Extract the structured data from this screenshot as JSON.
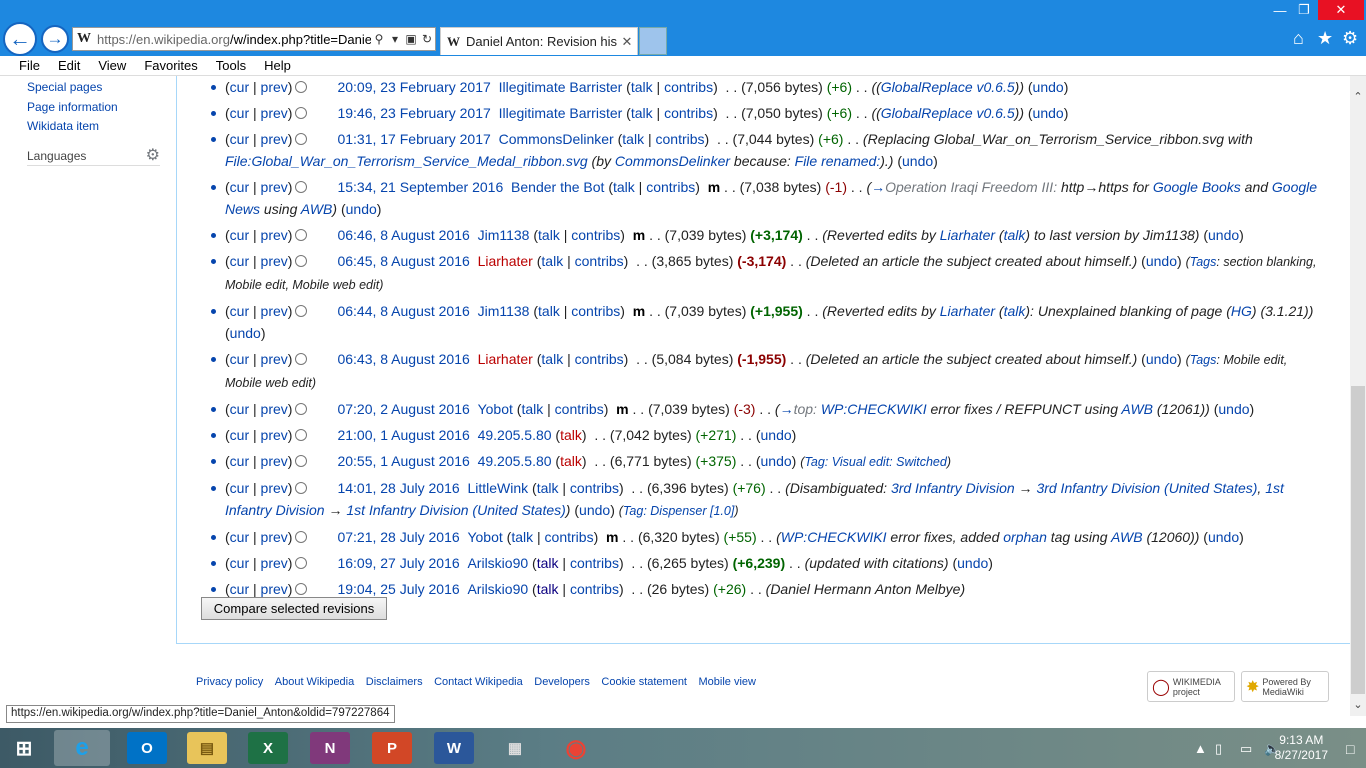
{
  "browser": {
    "address_host": "https://en.wikipedia.org",
    "address_path": "/w/index.php?title=Daniel_",
    "tab_title": "Daniel Anton: Revision hist...",
    "wiki_logo": "W"
  },
  "menu": [
    "File",
    "Edit",
    "View",
    "Favorites",
    "Tools",
    "Help"
  ],
  "sidebar": {
    "items": [
      "Special pages",
      "Page information",
      "Wikidata item"
    ],
    "languages": "Languages"
  },
  "compare_button": "Compare selected revisions",
  "footer_links": [
    "Privacy policy",
    "About Wikipedia",
    "Disclaimers",
    "Contact Wikipedia",
    "Developers",
    "Cookie statement",
    "Mobile view"
  ],
  "footer_badges": {
    "wikimedia": "WIKIMEDIA project",
    "mediawiki": "Powered By MediaWiki"
  },
  "status_url": "https://en.wikipedia.org/w/index.php?title=Daniel_Anton&oldid=797227864",
  "clock": {
    "time": "9:13 AM",
    "date": "8/27/2017"
  },
  "common": {
    "cur": "cur",
    "prev": "prev",
    "talk": "talk",
    "contribs": "contribs",
    "undo": "undo",
    "minor": "m"
  },
  "revisions": [
    {
      "date": "20:09, 23 February 2017",
      "user": "Illegitimate Barrister",
      "bytes": "(7,056 bytes)",
      "diff": "(+6)"
    },
    {
      "date": "19:46, 23 February 2017",
      "user": "Illegitimate Barrister",
      "bytes": "(7,050 bytes)",
      "diff": "(+6)"
    },
    {
      "date": "01:31, 17 February 2017",
      "user": "CommonsDelinker",
      "bytes": "(7,044 bytes)",
      "diff": "(+6)"
    },
    {
      "date": "15:34, 21 September 2016",
      "user": "Bender the Bot",
      "bytes": "(7,038 bytes)",
      "diff": "(-1)"
    },
    {
      "date": "06:46, 8 August 2016",
      "user": "Jim1138",
      "bytes": "(7,039 bytes)",
      "diff": "(+3,174)"
    },
    {
      "date": "06:45, 8 August 2016",
      "user": "Liarhater",
      "bytes": "(3,865 bytes)",
      "diff": "(-3,174)"
    },
    {
      "date": "06:44, 8 August 2016",
      "user": "Jim1138",
      "bytes": "(7,039 bytes)",
      "diff": "(+1,955)"
    },
    {
      "date": "06:43, 8 August 2016",
      "user": "Liarhater",
      "bytes": "(5,084 bytes)",
      "diff": "(-1,955)"
    },
    {
      "date": "07:20, 2 August 2016",
      "user": "Yobot",
      "bytes": "(7,039 bytes)",
      "diff": "(-3)"
    },
    {
      "date": "21:00, 1 August 2016",
      "user": "49.205.5.80",
      "bytes": "(7,042 bytes)",
      "diff": "(+271)"
    },
    {
      "date": "20:55, 1 August 2016",
      "user": "49.205.5.80",
      "bytes": "(6,771 bytes)",
      "diff": "(+375)"
    },
    {
      "date": "14:01, 28 July 2016",
      "user": "LittleWink",
      "bytes": "(6,396 bytes)",
      "diff": "(+76)"
    },
    {
      "date": "07:21, 28 July 2016",
      "user": "Yobot",
      "bytes": "(6,320 bytes)",
      "diff": "(+55)"
    },
    {
      "date": "16:09, 27 July 2016",
      "user": "Arilskio90",
      "bytes": "(6,265 bytes)",
      "diff": "(+6,239)"
    },
    {
      "date": "19:04, 25 July 2016",
      "user": "Arilskio90",
      "bytes": "(26 bytes)",
      "diff": "(+26)"
    }
  ],
  "summaries": {
    "gr_tool": "GlobalReplace v0.6.5",
    "r2_pre": "Replacing Global_War_on_Terrorism_Service_ribbon.svg with",
    "r2_file": "File:Global_War_on_Terrorism_Service_Medal_ribbon.svg",
    "r2_by": "by",
    "r2_because": "because:",
    "r2_reason": "File renamed:",
    "r3_section": "Operation Iraqi Freedom III:",
    "r3_text": "http→https for",
    "r3_gb": "Google Books",
    "r3_and": "and",
    "r3_gn": "Google News",
    "r3_using": "using",
    "awb": "AWB",
    "r4_pre": "Reverted edits by",
    "r4_post": "to last version by Jim1138",
    "r5_text": "Deleted an article the subject created about himself.",
    "tags": "Tags",
    "r5_tags": "section blanking, Mobile edit, Mobile web edit",
    "r6_post": "Unexplained blanking of page",
    "hg": "HG",
    "r6_ver": "(3.1.21)",
    "r7_tags": "Mobile edit, Mobile web edit",
    "r8_top": "top:",
    "checkwiki": "WP:CHECKWIKI",
    "r8_text": "error fixes / REFPUNCT using",
    "r8_ver": "(12061)",
    "r10_tag": "Tag: Visual edit: Switched",
    "r11_pre": "Disambiguated:",
    "r11_a": "3rd Infantry Division",
    "r11_b": "3rd Infantry Division (United States)",
    "r11_c": "1st Infantry Division",
    "r11_d": "1st Infantry Division (United States)",
    "r11_tag": "Tag: Dispenser [1.0]",
    "r12_text": "error fixes, added",
    "orphan": "orphan",
    "r12_tag": "tag using",
    "r12_ver": "(12060)",
    "r13_text": "updated with citations",
    "r14_text": "Daniel Hermann Anton Melbye"
  },
  "icons": [
    "back-icon",
    "forward-icon",
    "search-icon",
    "lock-icon",
    "refresh-icon",
    "close-icon",
    "home-icon",
    "star-icon",
    "gear-icon"
  ],
  "colors": {
    "link": "#0645ad",
    "redlink": "#ba0000",
    "positive": "#006400",
    "negative": "#8b0000",
    "chrome": "#1e88e0"
  }
}
